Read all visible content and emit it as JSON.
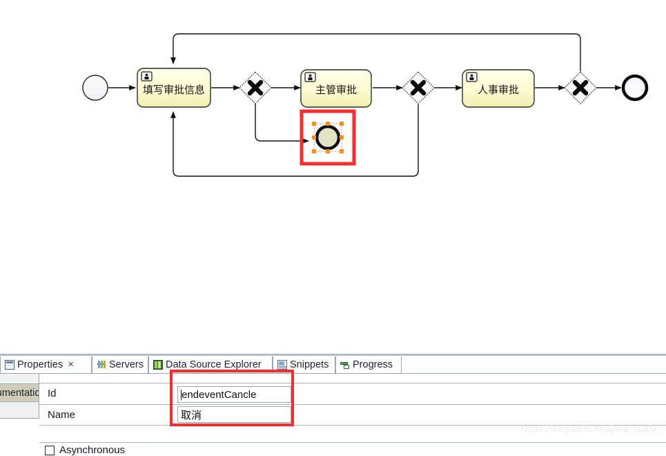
{
  "diagram": {
    "type": "bpmn-process",
    "nodes": [
      {
        "id": "start",
        "kind": "start-event",
        "label": ""
      },
      {
        "id": "task1",
        "kind": "user-task",
        "label": "填写审批信息"
      },
      {
        "id": "gw1",
        "kind": "exclusive-gateway",
        "label": ""
      },
      {
        "id": "task2",
        "kind": "user-task",
        "label": "主管审批"
      },
      {
        "id": "endCancel",
        "kind": "end-event-selected",
        "label": ""
      },
      {
        "id": "gw2",
        "kind": "exclusive-gateway",
        "label": ""
      },
      {
        "id": "task3",
        "kind": "user-task",
        "label": "人事审批"
      },
      {
        "id": "gw3",
        "kind": "exclusive-gateway",
        "label": ""
      },
      {
        "id": "end",
        "kind": "end-event",
        "label": ""
      }
    ],
    "colors": {
      "task_fill_top": "#ffffe0",
      "task_fill_bottom": "#f5f0b8",
      "task_border": "#2a2a2a",
      "selection_handle": "#f5901e",
      "highlight_red": "#fb2b2b",
      "end_event_fill": "#e2e2c4",
      "start_event_fill": "#f7f9fc",
      "gateway_fill": "#fcfcfc"
    }
  },
  "panel": {
    "tabs": [
      {
        "label": "Properties",
        "icon": "properties-icon",
        "active": true,
        "closable": true
      },
      {
        "label": "Servers",
        "icon": "servers-icon",
        "active": false,
        "closable": false
      },
      {
        "label": "Data Source Explorer",
        "icon": "data-source-explorer-icon",
        "active": false,
        "closable": false
      },
      {
        "label": "Snippets",
        "icon": "snippets-icon",
        "active": false,
        "closable": false
      },
      {
        "label": "Progress",
        "icon": "progress-icon",
        "active": false,
        "closable": false
      }
    ],
    "close_glyph": "✕",
    "side_tabs": [
      {
        "label": ""
      },
      {
        "label": "Documentation"
      },
      {
        "label": ""
      }
    ],
    "form": {
      "id_label": "Id",
      "id_value": "endeventCancle",
      "name_label": "Name",
      "name_value": "取消",
      "async_label": "Asynchronous",
      "async_checked": false
    }
  },
  "watermark": {
    "text": "https://blog.csdn.net/java_study_"
  }
}
